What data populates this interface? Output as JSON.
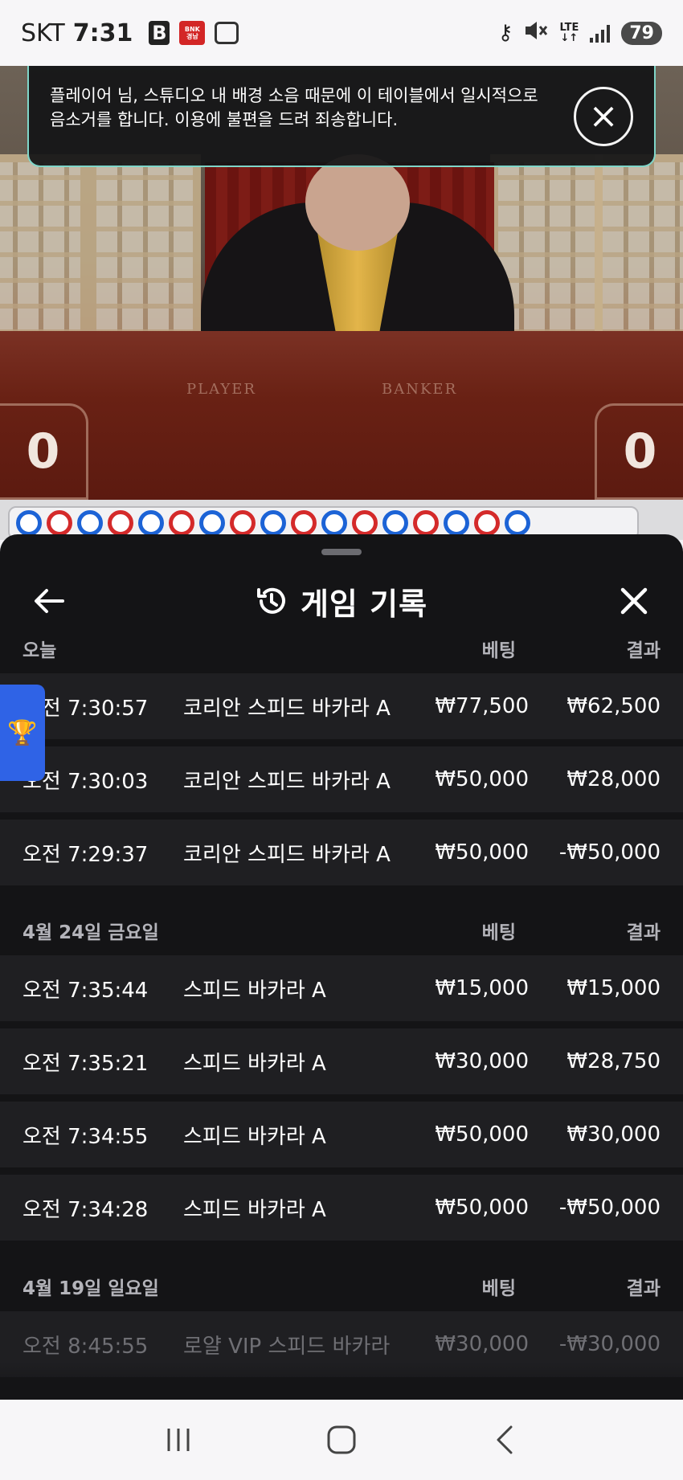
{
  "status_bar": {
    "carrier": "SKT",
    "time": "7:31",
    "app_b": "B",
    "app_bank": "BNK 경남은행",
    "network": "LTE",
    "battery": "79"
  },
  "video": {
    "player_label": "PLAYER",
    "banker_label": "BANKER",
    "player_score": "0",
    "banker_score": "0"
  },
  "notice": {
    "text": "플레이어 님, 스튜디오 내 배경 소음 때문에 이 테이블에서 일시적으로 음소거를 합니다. 이용에 불편을 드려 죄송합니다."
  },
  "bead_road": [
    "p",
    "b",
    "p",
    "b",
    "p",
    "b",
    "p",
    "b",
    "p",
    "b",
    "p",
    "b",
    "p",
    "b",
    "p",
    "b",
    "p"
  ],
  "colors": {
    "player": "#1c63d6",
    "banker": "#d42a2a",
    "accent": "#2f63e6",
    "notice_border": "#7fd6c9"
  },
  "sheet": {
    "title": "게임 기록",
    "sections": [
      {
        "date": "오늘",
        "bet_header": "베팅",
        "result_header": "결과",
        "rows": [
          {
            "time": "오전 7:30:57",
            "game": "코리안 스피드 바카라 A",
            "bet": "₩77,500",
            "result": "₩62,500"
          },
          {
            "time": "오전 7:30:03",
            "game": "코리안 스피드 바카라 A",
            "bet": "₩50,000",
            "result": "₩28,000"
          },
          {
            "time": "오전 7:29:37",
            "game": "코리안 스피드 바카라 A",
            "bet": "₩50,000",
            "result": "-₩50,000"
          }
        ]
      },
      {
        "date": "4월 24일 금요일",
        "bet_header": "베팅",
        "result_header": "결과",
        "rows": [
          {
            "time": "오전 7:35:44",
            "game": "스피드 바카라 A",
            "bet": "₩15,000",
            "result": "₩15,000"
          },
          {
            "time": "오전 7:35:21",
            "game": "스피드 바카라 A",
            "bet": "₩30,000",
            "result": "₩28,750"
          },
          {
            "time": "오전 7:34:55",
            "game": "스피드 바카라 A",
            "bet": "₩50,000",
            "result": "₩30,000"
          },
          {
            "time": "오전 7:34:28",
            "game": "스피드 바카라 A",
            "bet": "₩50,000",
            "result": "-₩50,000"
          }
        ]
      },
      {
        "date": "4월 19일 일요일",
        "bet_header": "베팅",
        "result_header": "결과",
        "rows": [
          {
            "time": "오전 8:45:55",
            "game": "로얄 VIP 스피드 바카라",
            "bet": "₩30,000",
            "result": "-₩30,000"
          }
        ]
      }
    ]
  },
  "icons": {
    "back": "arrow-left-icon",
    "history": "history-icon",
    "close": "close-icon",
    "trophy": "trophy-icon",
    "nav_recents": "recents-icon",
    "nav_home": "home-icon",
    "nav_back": "nav-back-icon"
  }
}
